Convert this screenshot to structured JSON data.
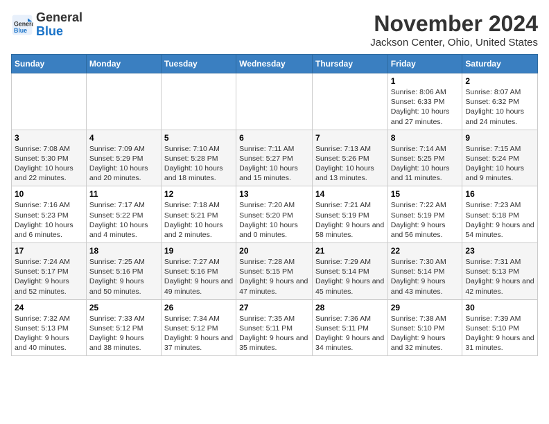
{
  "header": {
    "logo_line1": "General",
    "logo_line2": "Blue",
    "month": "November 2024",
    "location": "Jackson Center, Ohio, United States"
  },
  "days_of_week": [
    "Sunday",
    "Monday",
    "Tuesday",
    "Wednesday",
    "Thursday",
    "Friday",
    "Saturday"
  ],
  "weeks": [
    [
      {
        "day": "",
        "info": ""
      },
      {
        "day": "",
        "info": ""
      },
      {
        "day": "",
        "info": ""
      },
      {
        "day": "",
        "info": ""
      },
      {
        "day": "",
        "info": ""
      },
      {
        "day": "1",
        "info": "Sunrise: 8:06 AM\nSunset: 6:33 PM\nDaylight: 10 hours and 27 minutes."
      },
      {
        "day": "2",
        "info": "Sunrise: 8:07 AM\nSunset: 6:32 PM\nDaylight: 10 hours and 24 minutes."
      }
    ],
    [
      {
        "day": "3",
        "info": "Sunrise: 7:08 AM\nSunset: 5:30 PM\nDaylight: 10 hours and 22 minutes."
      },
      {
        "day": "4",
        "info": "Sunrise: 7:09 AM\nSunset: 5:29 PM\nDaylight: 10 hours and 20 minutes."
      },
      {
        "day": "5",
        "info": "Sunrise: 7:10 AM\nSunset: 5:28 PM\nDaylight: 10 hours and 18 minutes."
      },
      {
        "day": "6",
        "info": "Sunrise: 7:11 AM\nSunset: 5:27 PM\nDaylight: 10 hours and 15 minutes."
      },
      {
        "day": "7",
        "info": "Sunrise: 7:13 AM\nSunset: 5:26 PM\nDaylight: 10 hours and 13 minutes."
      },
      {
        "day": "8",
        "info": "Sunrise: 7:14 AM\nSunset: 5:25 PM\nDaylight: 10 hours and 11 minutes."
      },
      {
        "day": "9",
        "info": "Sunrise: 7:15 AM\nSunset: 5:24 PM\nDaylight: 10 hours and 9 minutes."
      }
    ],
    [
      {
        "day": "10",
        "info": "Sunrise: 7:16 AM\nSunset: 5:23 PM\nDaylight: 10 hours and 6 minutes."
      },
      {
        "day": "11",
        "info": "Sunrise: 7:17 AM\nSunset: 5:22 PM\nDaylight: 10 hours and 4 minutes."
      },
      {
        "day": "12",
        "info": "Sunrise: 7:18 AM\nSunset: 5:21 PM\nDaylight: 10 hours and 2 minutes."
      },
      {
        "day": "13",
        "info": "Sunrise: 7:20 AM\nSunset: 5:20 PM\nDaylight: 10 hours and 0 minutes."
      },
      {
        "day": "14",
        "info": "Sunrise: 7:21 AM\nSunset: 5:19 PM\nDaylight: 9 hours and 58 minutes."
      },
      {
        "day": "15",
        "info": "Sunrise: 7:22 AM\nSunset: 5:19 PM\nDaylight: 9 hours and 56 minutes."
      },
      {
        "day": "16",
        "info": "Sunrise: 7:23 AM\nSunset: 5:18 PM\nDaylight: 9 hours and 54 minutes."
      }
    ],
    [
      {
        "day": "17",
        "info": "Sunrise: 7:24 AM\nSunset: 5:17 PM\nDaylight: 9 hours and 52 minutes."
      },
      {
        "day": "18",
        "info": "Sunrise: 7:25 AM\nSunset: 5:16 PM\nDaylight: 9 hours and 50 minutes."
      },
      {
        "day": "19",
        "info": "Sunrise: 7:27 AM\nSunset: 5:16 PM\nDaylight: 9 hours and 49 minutes."
      },
      {
        "day": "20",
        "info": "Sunrise: 7:28 AM\nSunset: 5:15 PM\nDaylight: 9 hours and 47 minutes."
      },
      {
        "day": "21",
        "info": "Sunrise: 7:29 AM\nSunset: 5:14 PM\nDaylight: 9 hours and 45 minutes."
      },
      {
        "day": "22",
        "info": "Sunrise: 7:30 AM\nSunset: 5:14 PM\nDaylight: 9 hours and 43 minutes."
      },
      {
        "day": "23",
        "info": "Sunrise: 7:31 AM\nSunset: 5:13 PM\nDaylight: 9 hours and 42 minutes."
      }
    ],
    [
      {
        "day": "24",
        "info": "Sunrise: 7:32 AM\nSunset: 5:13 PM\nDaylight: 9 hours and 40 minutes."
      },
      {
        "day": "25",
        "info": "Sunrise: 7:33 AM\nSunset: 5:12 PM\nDaylight: 9 hours and 38 minutes."
      },
      {
        "day": "26",
        "info": "Sunrise: 7:34 AM\nSunset: 5:12 PM\nDaylight: 9 hours and 37 minutes."
      },
      {
        "day": "27",
        "info": "Sunrise: 7:35 AM\nSunset: 5:11 PM\nDaylight: 9 hours and 35 minutes."
      },
      {
        "day": "28",
        "info": "Sunrise: 7:36 AM\nSunset: 5:11 PM\nDaylight: 9 hours and 34 minutes."
      },
      {
        "day": "29",
        "info": "Sunrise: 7:38 AM\nSunset: 5:10 PM\nDaylight: 9 hours and 32 minutes."
      },
      {
        "day": "30",
        "info": "Sunrise: 7:39 AM\nSunset: 5:10 PM\nDaylight: 9 hours and 31 minutes."
      }
    ]
  ]
}
